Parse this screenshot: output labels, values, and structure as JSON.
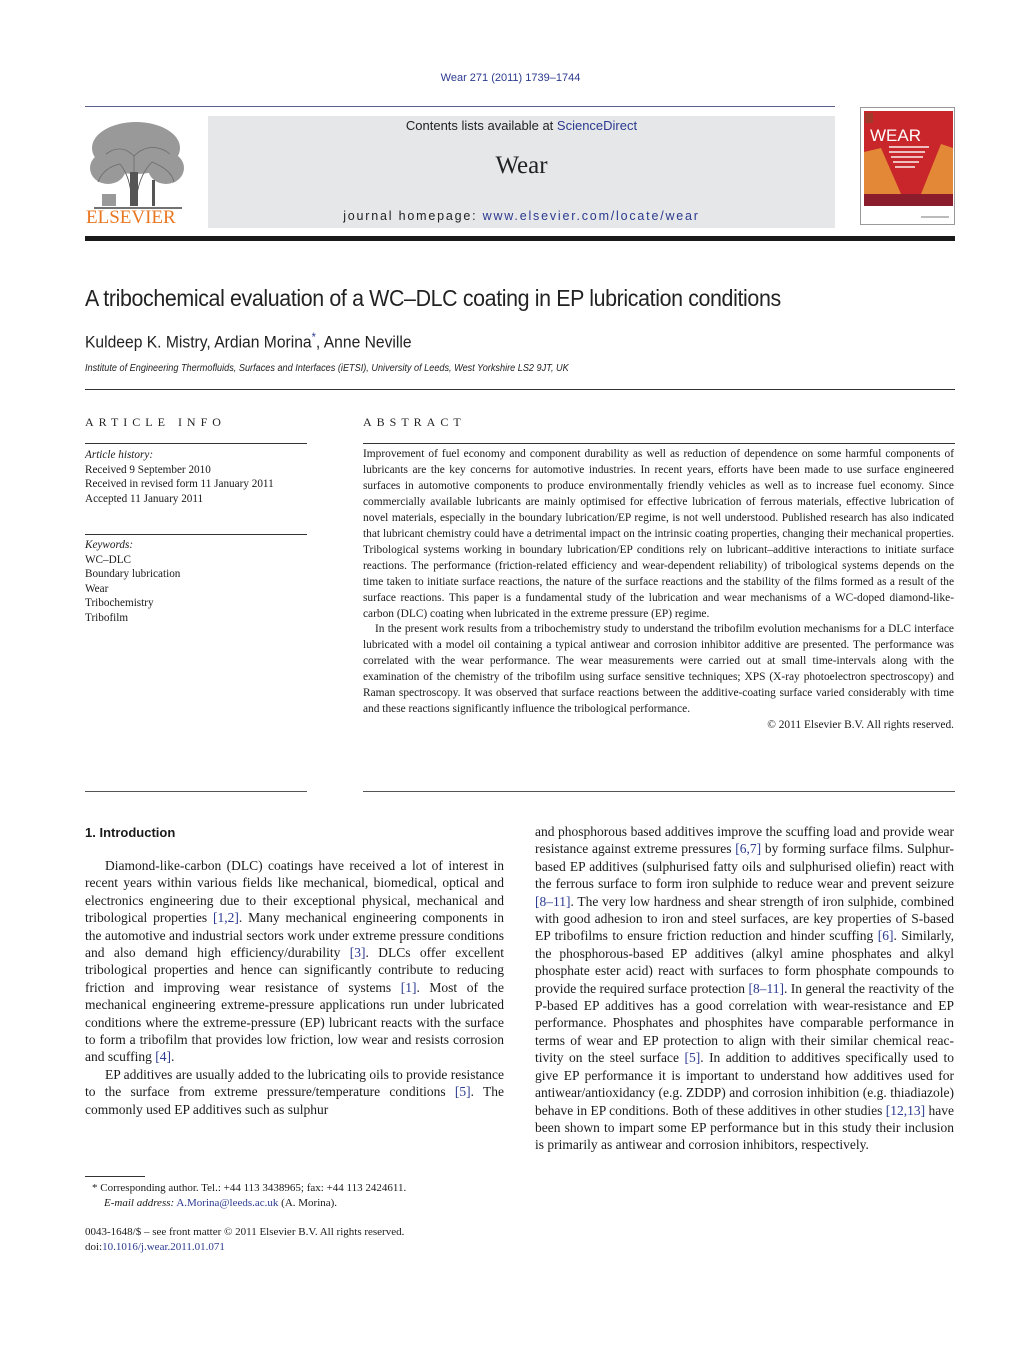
{
  "header": {
    "journal_ref": "Wear 271 (2011) 1739–1744",
    "contents_prefix": "Contents lists available at ",
    "contents_link": "ScienceDirect",
    "journal_name": "Wear",
    "homepage_prefix": "journal homepage: ",
    "homepage_url": "www.elsevier.com/locate/wear",
    "publisher_logo_text": "ELSEVIER",
    "cover_title": "WEAR",
    "colors": {
      "link": "#2b3a8f",
      "publisher_orange": "#e87722",
      "cover_red": "#c8262a",
      "cover_band": "#8a1c2c"
    }
  },
  "article": {
    "title": "A tribochemical evaluation of a WC–DLC coating in EP lubrication conditions",
    "authors": [
      {
        "name": "Kuldeep K. Mistry",
        "corresponding": false
      },
      {
        "name": "Ardian Morina",
        "corresponding": true
      },
      {
        "name": "Anne Neville",
        "corresponding": false
      }
    ],
    "author_sep": ", ",
    "corresponding_mark": "*",
    "affiliation": "Institute of Engineering Thermofluids, Surfaces and Interfaces (iETSI), University of Leeds, West Yorkshire LS2 9JT, UK"
  },
  "article_info": {
    "heading": "ARTICLE INFO",
    "history_label": "Article history:",
    "history": [
      "Received 9 September 2010",
      "Received in revised form 11 January 2011",
      "Accepted 11 January 2011"
    ],
    "keywords_label": "Keywords:",
    "keywords": [
      "WC–DLC",
      "Boundary lubrication",
      "Wear",
      "Tribochemistry",
      "Tribofilm"
    ]
  },
  "abstract": {
    "heading": "ABSTRACT",
    "paragraphs": [
      "Improvement of fuel economy and component durability as well as reduction of dependence on some harmful components of lubricants are the key concerns for automotive industries. In recent years, efforts have been made to use surface engineered surfaces in automotive components to produce environ­mentally friendly vehicles as well as to increase fuel economy. Since commercially available lubricants are mainly optimised for effective lubrication of ferrous materials, effective lubrication of novel mate­rials, especially in the boundary lubrication/EP regime, is not well understood. Published research has also indicated that lubricant chemistry could have a detrimental impact on the intrinsic coating prop­erties, changing their mechanical properties. Tribological systems working in boundary lubrication/EP conditions rely on lubricant–additive interactions to initiate surface reactions. The performance (friction-related efficiency and wear-dependent reliability) of tribological systems depends on the time taken to initiate surface reactions, the nature of the surface reactions and the stability of the films formed as a result of the surface reactions. This paper is a fundamental study of the lubrication and wear mechanisms of a WC-doped diamond-like-carbon (DLC) coating when lubricated in the extreme pressure (EP) regime.",
      "In the present work results from a tribochemistry study to understand the tribofilm evolution mecha­nisms for a DLC interface lubricated with a model oil containing a typical antiwear and corrosion inhibitor additive are presented. The performance was correlated with the wear performance. The wear mea­surements were carried out at small time-intervals along with the examination of the chemistry of the tribofilm using surface sensitive techniques; XPS (X-ray photoelectron spectroscopy) and Raman spec­troscopy. It was observed that surface reactions between the additive-coating surface varied considerably with time and these reactions significantly influence the tribological performance."
    ],
    "copyright": "© 2011 Elsevier B.V. All rights reserved."
  },
  "introduction": {
    "heading": "1.  Introduction",
    "left_paragraphs": [
      [
        {
          "t": "Diamond-like-carbon (DLC) coatings have received a lot of inter­est in recent years within various fields like mechanical, biomedical, optical and electronics engineering due to their exceptional physi­cal, mechanical and tribological properties "
        },
        {
          "ref": "[1,2]"
        },
        {
          "t": ". Many mechanical engineering components in the automotive and industrial sectors work under extreme pressure conditions and also demand high efficiency/durability "
        },
        {
          "ref": "[3]"
        },
        {
          "t": ". DLCs offer excellent tribological proper­ties and hence can significantly contribute to reducing friction and improving wear resistance of systems "
        },
        {
          "ref": "[1]"
        },
        {
          "t": ". Most of the mechanical engineering extreme-pressure applications run under lubricated conditions where the extreme-pressure (EP) lubricant reacts with the surface to form a tribofilm that provides low friction, low wear and resists corrosion and scuffing "
        },
        {
          "ref": "[4]"
        },
        {
          "t": "."
        }
      ],
      [
        {
          "t": "EP additives are usually added to the lubricating oils to pro­vide resistance to the surface from extreme pressure/temperature conditions "
        },
        {
          "ref": "[5]"
        },
        {
          "t": ". The commonly used EP additives such as sulphur"
        }
      ]
    ],
    "right_paragraphs": [
      [
        {
          "t": "and phosphorous based additives improve the scuffing load and provide wear resistance against extreme pressures "
        },
        {
          "ref": "[6,7]"
        },
        {
          "t": " by form­ing surface films. Sulphur-based EP additives (sulphurised fatty oils and sulphurised oliefin) react with the ferrous surface to form iron sulphide to reduce wear and prevent seizure "
        },
        {
          "ref": "[8–11]"
        },
        {
          "t": ". The very low hardness and shear strength of iron sulphide, combined with good adhesion to iron and steel surfaces, are key properties of S-based EP tribofilms to ensure friction reduction and hinder scuffing "
        },
        {
          "ref": "[6]"
        },
        {
          "t": ". Similarly, the phosphorous-based EP additives (alkyl amine phos­phates and alkyl phosphate ester acid) react with surfaces to form phosphate compounds to provide the required surface protection "
        },
        {
          "ref": "[8–11]"
        },
        {
          "t": ". In general the reactivity of the P-based EP additives has a good correlation with wear-resistance and EP performance. Phos­phates and phosphites have comparable performance in terms of wear and EP protection to align with their similar chemical reac­tivity on the steel surface "
        },
        {
          "ref": "[5]"
        },
        {
          "t": ". In addition to additives specifically used to give EP performance it is important to understand how additives used for antiwear/antioxidancy (e.g. ZDDP) and corro­sion inhibition (e.g. thiadiazole) behave in EP conditions. Both of these additives in other studies "
        },
        {
          "ref": "[12,13]"
        },
        {
          "t": " have been shown to impart some EP performance but in this study their inclusion is primarily as antiwear and corrosion inhibitors, respectively."
        }
      ]
    ]
  },
  "footnote": {
    "mark": "*",
    "corresponding_text": "Corresponding author. Tel.: +44 113 3438965; fax: +44 113 2424611.",
    "email_label": "E-mail address:",
    "email": "A.Morina@leeds.ac.uk",
    "email_suffix": " (A. Morina)."
  },
  "front_matter": {
    "issn_line": "0043-1648/$ – see front matter © 2011 Elsevier B.V. All rights reserved.",
    "doi_prefix": "doi:",
    "doi": "10.1016/j.wear.2011.01.071"
  }
}
